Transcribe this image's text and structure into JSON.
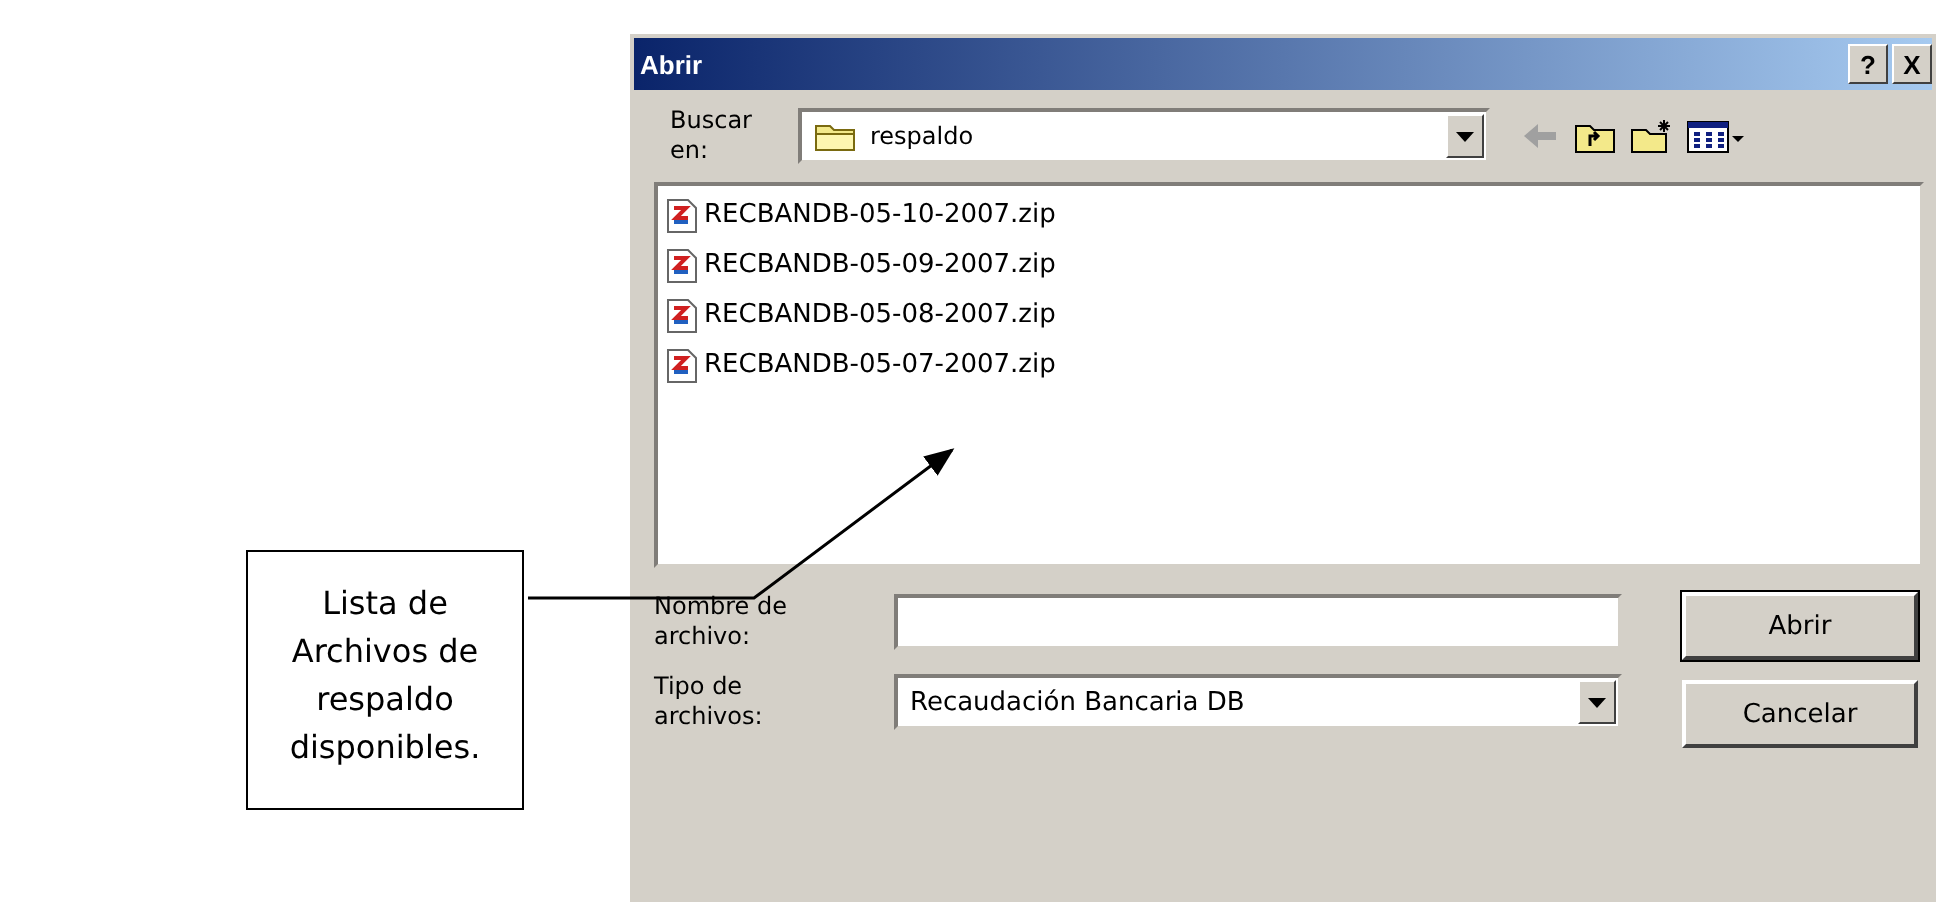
{
  "callout": {
    "text": "Lista de Archivos de respaldo disponibles."
  },
  "window": {
    "title": "Abrir",
    "buttons": [
      "?",
      "X"
    ]
  },
  "look_in": {
    "label": "Buscar en:",
    "value": "respaldo"
  },
  "files": [
    {
      "name": "RECBANDB-05-10-2007.zip"
    },
    {
      "name": "RECBANDB-05-09-2007.zip"
    },
    {
      "name": "RECBANDB-05-08-2007.zip"
    },
    {
      "name": "RECBANDB-05-07-2007.zip"
    }
  ],
  "file_name": {
    "label": "Nombre de archivo:"
  },
  "file_type": {
    "label": "Tipo de archivos:",
    "value": "Recaudación Bancaria DB"
  },
  "actions": [
    {
      "label": "Abrir",
      "default": true
    },
    {
      "label": "Cancelar",
      "default": false
    }
  ]
}
